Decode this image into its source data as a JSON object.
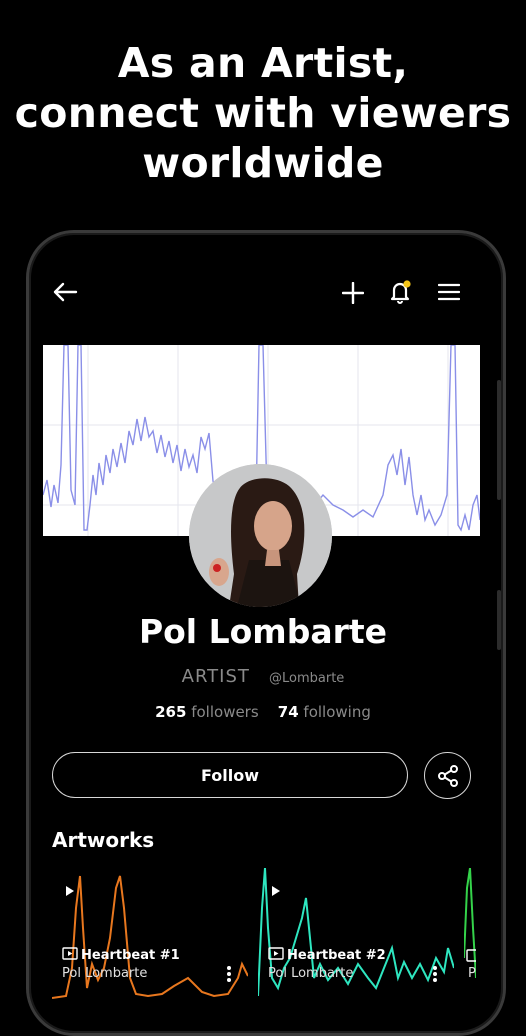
{
  "headline": {
    "line1": "As an Artist,",
    "line2": "connect with viewers",
    "line3": "worldwide"
  },
  "topbar": {
    "back_icon": "arrow-left-icon",
    "add_icon": "plus-icon",
    "notification_icon": "bell-icon",
    "menu_icon": "hamburger-menu-icon",
    "notification_dot_color": "#f5c518"
  },
  "profile": {
    "name": "Pol Lombarte",
    "role": "ARTIST",
    "handle": "@Lombarte",
    "followers_count": "265",
    "followers_label": "followers",
    "following_count": "74",
    "following_label": "following",
    "follow_label": "Follow",
    "share_icon": "share-icon"
  },
  "artworks": {
    "section_title": "Artworks",
    "items": [
      {
        "title": "Heartbeat #1",
        "artist": "Pol Lombarte",
        "color": "#e8771e"
      },
      {
        "title": "Heartbeat #2",
        "artist": "Pol Lombarte",
        "color": "#2ee6c0"
      },
      {
        "title": "",
        "artist": "",
        "color": "#34d34a"
      }
    ]
  }
}
